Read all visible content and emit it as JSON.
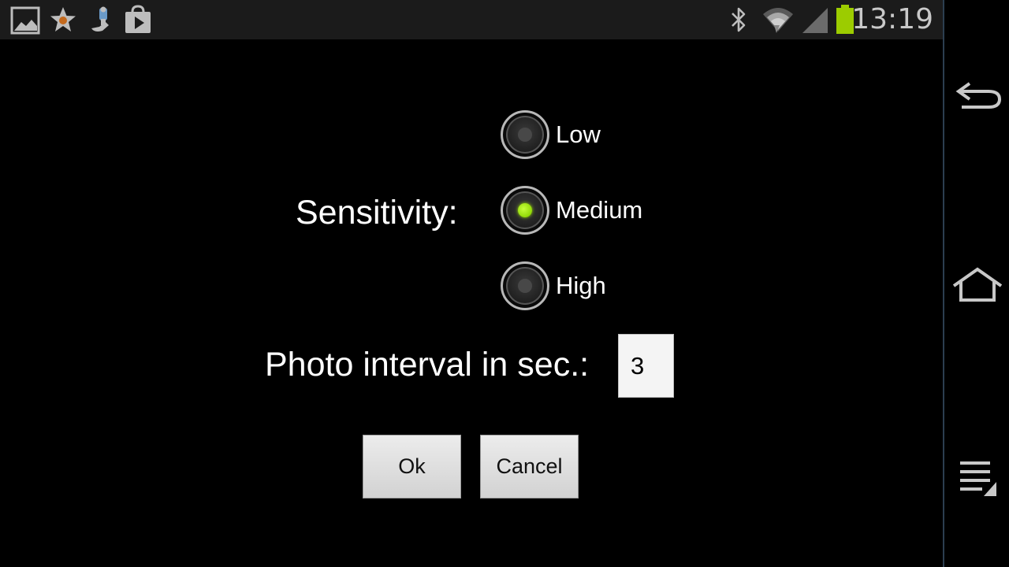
{
  "status_bar": {
    "time": "13:19",
    "left_icons": [
      "gallery-notification-icon",
      "favorite-star-icon",
      "upload-notification-icon",
      "play-store-icon"
    ],
    "right_icons": [
      "bluetooth-icon",
      "wifi-icon",
      "signal-icon",
      "battery-icon"
    ],
    "battery_color": "#9ccc00"
  },
  "form": {
    "sensitivity_label": "Sensitivity:",
    "options": [
      "Low",
      "Medium",
      "High"
    ],
    "selected_option": "Medium",
    "interval_label": "Photo interval in sec.:",
    "interval_value": "3",
    "ok_label": "Ok",
    "cancel_label": "Cancel",
    "accent_color": "#9be000"
  },
  "nav_bar": {
    "buttons": [
      "back-icon",
      "home-icon",
      "menu-icon"
    ]
  }
}
